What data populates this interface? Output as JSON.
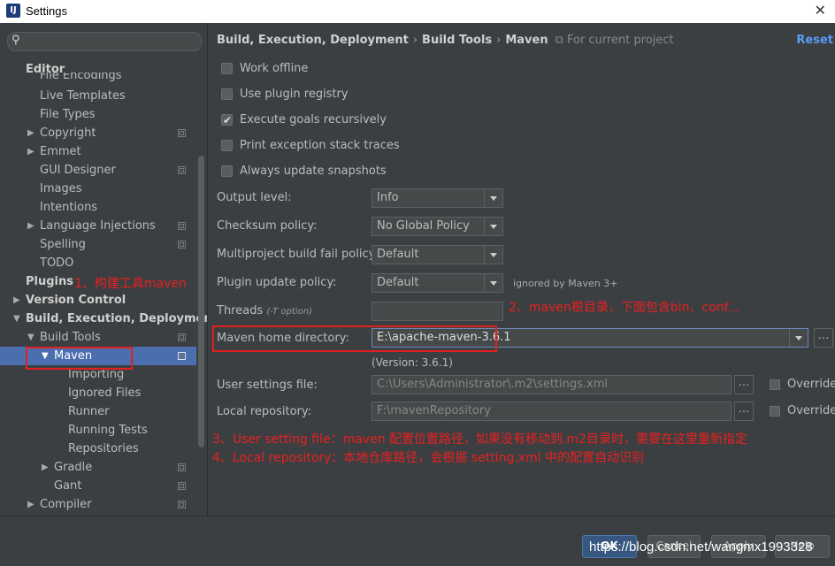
{
  "window": {
    "title": "Settings",
    "close_glyph": "✕"
  },
  "sidebar": {
    "search_placeholder": "",
    "items": [
      {
        "label": "Editor",
        "bold": true
      },
      {
        "label": "File Encodings"
      },
      {
        "label": "Live Templates"
      },
      {
        "label": "File Types"
      },
      {
        "label": "Copyright"
      },
      {
        "label": "Emmet"
      },
      {
        "label": "GUI Designer"
      },
      {
        "label": "Images"
      },
      {
        "label": "Intentions"
      },
      {
        "label": "Language Injections"
      },
      {
        "label": "Spelling"
      },
      {
        "label": "TODO"
      },
      {
        "label": "Plugins",
        "bold": true
      },
      {
        "label": "Version Control",
        "bold": true
      },
      {
        "label": "Build, Execution, Deployment",
        "bold": true
      },
      {
        "label": "Build Tools"
      },
      {
        "label": "Maven",
        "selected": true
      },
      {
        "label": "Importing"
      },
      {
        "label": "Ignored Files"
      },
      {
        "label": "Runner"
      },
      {
        "label": "Running Tests"
      },
      {
        "label": "Repositories"
      },
      {
        "label": "Gradle"
      },
      {
        "label": "Gant"
      },
      {
        "label": "Compiler"
      }
    ]
  },
  "breadcrumb": {
    "parts": [
      "Build, Execution, Deployment",
      "Build Tools",
      "Maven"
    ],
    "separator": "›",
    "scope": "For current project",
    "reset": "Reset"
  },
  "checkboxes": [
    {
      "label": "Work offline",
      "checked": false
    },
    {
      "label": "Use plugin registry",
      "checked": false
    },
    {
      "label": "Execute goals recursively",
      "checked": true
    },
    {
      "label": "Print exception stack traces",
      "checked": false
    },
    {
      "label": "Always update snapshots",
      "checked": false
    }
  ],
  "form": {
    "output_level": {
      "label": "Output level:",
      "value": "Info"
    },
    "checksum_policy": {
      "label": "Checksum policy:",
      "value": "No Global Policy"
    },
    "fail_policy": {
      "label": "Multiproject build fail policy:",
      "value": "Default"
    },
    "plugin_update": {
      "label": "Plugin update policy:",
      "value": "Default",
      "note": "ignored by Maven 3+"
    },
    "threads": {
      "label": "Threads",
      "hint": "(-T option)",
      "value": ""
    },
    "maven_home": {
      "label": "Maven home directory:",
      "value": "E:\\apache-maven-3.6.1",
      "version": "(Version: 3.6.1)"
    },
    "user_settings": {
      "label": "User settings file:",
      "value": "C:\\Users\\Administrator\\.m2\\settings.xml",
      "override": "Override"
    },
    "local_repo": {
      "label": "Local repository:",
      "value": "F:\\mavenRepository",
      "override": "Override"
    }
  },
  "annotations": {
    "a1": "1、构建工具maven",
    "a2": "2、maven根目录，下面包含bin、conf...",
    "a3": "3、User setting file：maven 配置位置路径，如果没有移动到.m2目录时，需要在这里重新指定",
    "a4": "4、Local repository：本地仓库路径，会根据 setting.xml 中的配置自动识别"
  },
  "footer": {
    "ok": "OK",
    "cancel": "Cancel",
    "apply": "Apply",
    "help": "Help"
  },
  "watermark": "https://blog.csdn.net/wangmx1993328",
  "colors": {
    "accent": "#4b6eaf",
    "annotation": "#e02020",
    "link": "#589df6"
  }
}
